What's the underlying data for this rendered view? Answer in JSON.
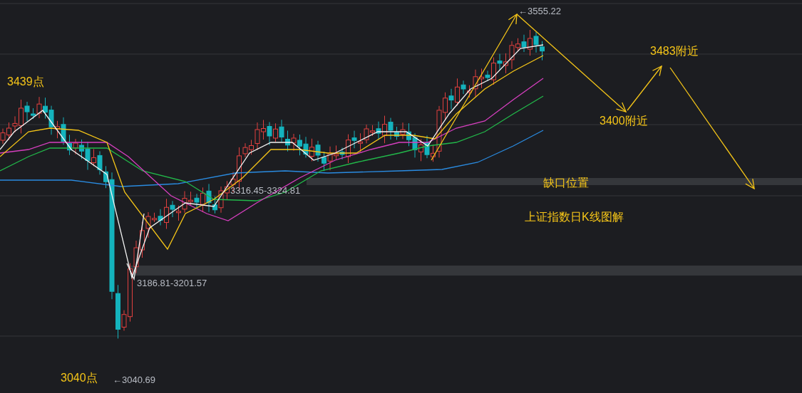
{
  "chart": {
    "labels": [
      {
        "kind": "value",
        "text": "←3555.22"
      },
      {
        "kind": "target",
        "text": "3483附近"
      },
      {
        "kind": "target",
        "text": "3439点"
      },
      {
        "kind": "target",
        "text": "3400附近"
      },
      {
        "kind": "target",
        "text": "缺口位置"
      },
      {
        "kind": "value",
        "text": "3316.45-3324.81"
      },
      {
        "kind": "target",
        "text": "上证指数日K线图解"
      },
      {
        "kind": "value",
        "text": "3186.81-3201.57"
      },
      {
        "kind": "target",
        "text": "3040点"
      },
      {
        "kind": "value",
        "text": "←3040.69"
      }
    ]
  }
}
